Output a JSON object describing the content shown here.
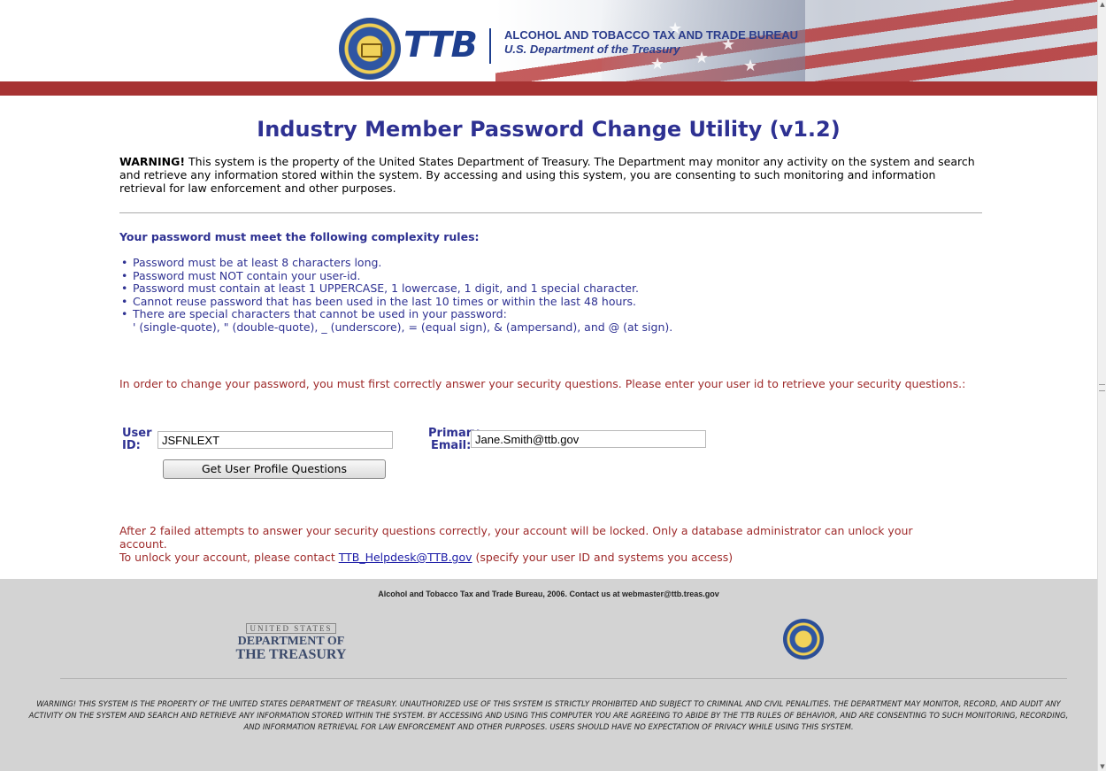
{
  "header": {
    "logo_text": "TTB",
    "bureau_name": "ALCOHOL AND TOBACCO TAX AND TRADE BUREAU",
    "department": "U.S. Department of the Treasury"
  },
  "main": {
    "title": "Industry Member Password Change Utility (v1.2)",
    "warning_label": "WARNING!",
    "warning_text": " This system is the property of the United States Department of Treasury. The Department may monitor any activity on the system and search and retrieve any information stored within the system. By accessing and using this system, you are consenting to such monitoring and information retrieval for law enforcement and other purposes.",
    "rules_heading": "Your password must meet the following complexity rules:",
    "rules": [
      "Password must be at least 8 characters long.",
      "Password must NOT contain your user-id.",
      "Password must contain at least 1 UPPERCASE, 1 lowercase, 1 digit, and 1 special character.",
      "Cannot reuse password that has been used in the last 10 times or within the last 48 hours.",
      "There are special characters that cannot be used in your password:"
    ],
    "rules_continuation": "' (single-quote), \" (double-quote), _ (underscore), = (equal sign), & (ampersand), and @ (at sign).",
    "instructions": "In order to change your password, you must first correctly answer your security questions. Please enter your user id to retrieve your security questions.:",
    "form": {
      "user_id_label_1": "User",
      "user_id_label_2": "ID:",
      "user_id_value": "JSFNLEXT",
      "email_label_1": "Primary",
      "email_label_2": "Email:",
      "email_value": "Jane.Smith@ttb.gov",
      "submit_label": "Get User Profile Questions"
    },
    "lock_note_1": "After 2 failed attempts to answer your security questions correctly, your account will be locked. Only a database administrator can unlock your account.",
    "lock_note_2_prefix": "To unlock your account, please contact ",
    "helpdesk_link": "TTB_Helpdesk@TTB.gov",
    "lock_note_2_suffix": " (specify your user ID and systems you access)"
  },
  "footer": {
    "contact": "Alcohol and Tobacco Tax and Trade Bureau, 2006. Contact us at webmaster@ttb.treas.gov",
    "treasury_logo": {
      "line1": "UNITED STATES",
      "line2": "DEPARTMENT OF",
      "line3": "THE TREASURY"
    },
    "warning": "WARNING! THIS SYSTEM IS THE PROPERTY OF THE UNITED STATES DEPARTMENT OF TREASURY. UNAUTHORIZED USE OF THIS SYSTEM IS STRICTLY PROHIBITED AND SUBJECT TO CRIMINAL AND CIVIL PENALITIES. THE DEPARTMENT MAY MONITOR, RECORD, AND AUDIT ANY ACTIVITY ON THE SYSTEM AND SEARCH AND RETRIEVE ANY INFORMATION STORED WITHIN THE SYSTEM. BY ACCESSING AND USING THIS COMPUTER YOU ARE AGREEING TO ABIDE BY THE TTB RULES OF BEHAVIOR, AND ARE CONSENTING TO SUCH MONITORING, RECORDING, AND INFORMATION RETRIEVAL FOR LAW ENFORCEMENT AND OTHER PURPOSES. USERS SHOULD HAVE NO EXPECTATION OF PRIVACY WHILE USING THIS SYSTEM."
  },
  "colors": {
    "title_blue": "#2e3192",
    "alert_red": "#9e2a2a",
    "header_band": "#a73333",
    "footer_gray": "#d3d3d3"
  },
  "icons": [
    "ttb-seal-icon",
    "treasury-seal-icon",
    "flag-banner-icon"
  ]
}
